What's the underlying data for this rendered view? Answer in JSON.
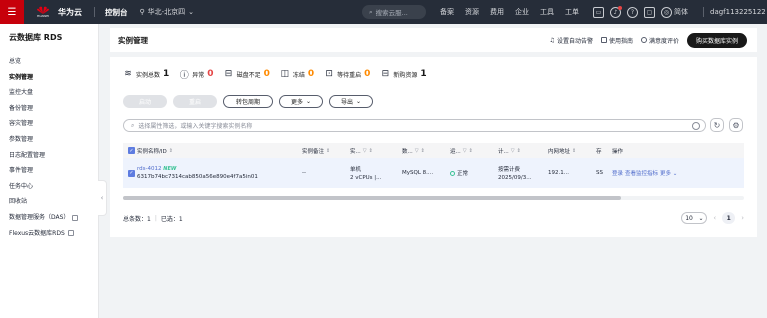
{
  "topbar": {
    "menu_icon": "menu-icon",
    "logo_text": "HUAWEI",
    "brand": "华为云",
    "console": "控制台",
    "region": "华北-北京四",
    "search_placeholder": "搜索云服...",
    "nav": [
      "备案",
      "资源",
      "费用",
      "企业",
      "工具",
      "工单"
    ],
    "lang": "简体",
    "user": "dagf113225122"
  },
  "sidebar": {
    "title": "云数据库 RDS",
    "items": [
      {
        "label": "总览",
        "active": false,
        "external": false
      },
      {
        "label": "实例管理",
        "active": true,
        "external": false
      },
      {
        "label": "监控大盘",
        "active": false,
        "external": false
      },
      {
        "label": "备份管理",
        "active": false,
        "external": false
      },
      {
        "label": "容灾管理",
        "active": false,
        "external": false
      },
      {
        "label": "参数管理",
        "active": false,
        "external": false
      },
      {
        "label": "日志配置管理",
        "active": false,
        "external": false
      },
      {
        "label": "事件管理",
        "active": false,
        "external": false
      },
      {
        "label": "任务中心",
        "active": false,
        "external": false
      },
      {
        "label": "回收站",
        "active": false,
        "external": false
      },
      {
        "label": "数据管理服务（DAS）",
        "active": false,
        "external": true
      },
      {
        "label": "Flexus云数据库RDS",
        "active": false,
        "external": true
      }
    ]
  },
  "header": {
    "title": "实例管理",
    "actions": [
      "设置自动告警",
      "使用指南",
      "满意度评价"
    ],
    "buy_button": "购买数据库实例"
  },
  "stats": [
    {
      "label": "实例总数",
      "value": "1",
      "tone": "normal"
    },
    {
      "label": "异常",
      "value": "0",
      "tone": "orange"
    },
    {
      "label": "磁盘不足",
      "value": "0",
      "tone": "warn"
    },
    {
      "label": "冻结",
      "value": "0",
      "tone": "warn"
    },
    {
      "label": "等待重启",
      "value": "0",
      "tone": "warn"
    },
    {
      "label": "新购资源",
      "value": "1",
      "tone": "normal"
    }
  ],
  "buttons": {
    "start": "启动",
    "stop": "重启",
    "renew": "转包周期",
    "more": "更多",
    "export": "导出"
  },
  "filter": {
    "placeholder": "选择属性筛选，或输入关键字搜索实例名称"
  },
  "table": {
    "headers": [
      "实例名称/ID",
      "实例备注",
      "实...",
      "数...",
      "运...",
      "计...",
      "内网地址",
      "存",
      "操作"
    ],
    "row": {
      "name": "rds-4012",
      "badge": "NEW",
      "id": "6317b74bc7314cab850a56e890e4f7a5in01",
      "remark": "--",
      "type_line1": "单机",
      "type_line2": "2 vCPUs |...",
      "engine": "MySQL 8....",
      "status": "正常",
      "billing_line1": "按需计费",
      "billing_line2": "2025/09/3...",
      "ip": "192.1...",
      "storage": "SS",
      "op_login": "登录",
      "op_monitor": "查看监控指标",
      "op_more": "更多"
    }
  },
  "footer": {
    "total": "总条数：1",
    "selected": "已选：1",
    "page_size": "10",
    "current_page": "1"
  },
  "colors": {
    "topbar": "#262d39",
    "brand_red": "#c7000b",
    "link": "#526ecc",
    "success": "#3ac295",
    "selected_row": "#eef3fd"
  }
}
